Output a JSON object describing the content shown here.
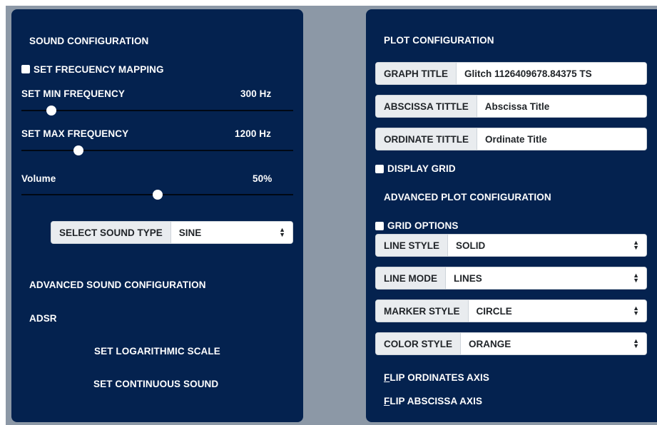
{
  "sound": {
    "title": "SOUND CONFIGURATION",
    "mapping_label": "SET FRECUENCY MAPPING",
    "min_freq": {
      "label": "SET MIN FREQUENCY",
      "value_text": "300 Hz",
      "level": 0.11
    },
    "max_freq": {
      "label": "SET MAX FREQUENCY",
      "value_text": "1200 Hz",
      "level": 0.21
    },
    "volume": {
      "label": "Volume",
      "value_text": "50%",
      "level": 0.5
    },
    "sound_type": {
      "label": "SELECT SOUND TYPE",
      "selected": "SINE"
    },
    "advanced_title": "ADVANCED SOUND CONFIGURATION",
    "adsr": "ADSR",
    "log_scale": "SET LOGARITHMIC SCALE",
    "continuous": "SET CONTINUOUS SOUND"
  },
  "plot": {
    "title": "PLOT CONFIGURATION",
    "graph_title": {
      "label": "GRAPH TITLE",
      "value": "Glitch 1126409678.84375 TS"
    },
    "abscissa_title": {
      "label": "ABSCISSA TITTLE",
      "value": "Abscissa Title"
    },
    "ordinate_title": {
      "label": "ORDINATE TITTLE",
      "value": "Ordinate Title"
    },
    "display_grid": "DISPLAY GRID",
    "advanced_title": "ADVANCED PLOT CONFIGURATION",
    "grid_options": "GRID OPTIONS",
    "line_style": {
      "label": "LINE STYLE",
      "selected": "SOLID"
    },
    "line_mode": {
      "label": "LINE MODE",
      "selected": "LINES"
    },
    "marker_style": {
      "label": "MARKER STYLE",
      "selected": "CIRCLE"
    },
    "color_style": {
      "label": "COLOR STYLE",
      "selected": "ORANGE"
    },
    "flip_ordinates": "FLIP ORDINATES AXIS",
    "flip_abscissa": "FLIP ABSCISSA AXIS"
  },
  "colors": {
    "panel_bg": "#04224f",
    "backdrop": "#8c98a6",
    "addon_bg": "#e9ecef"
  },
  "icons": {
    "select_arrow": "up-down-chevron-icon"
  }
}
